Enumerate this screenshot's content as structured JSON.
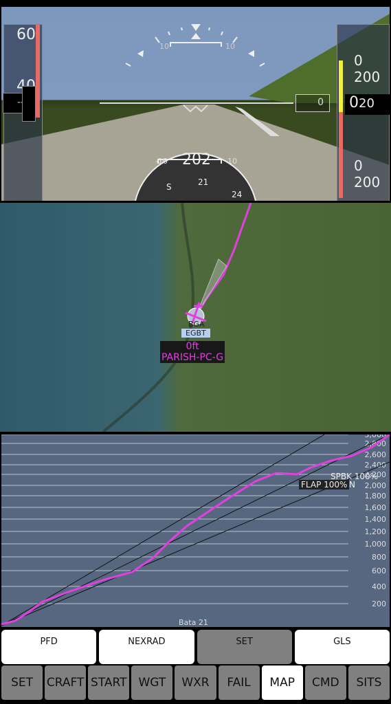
{
  "pfd": {
    "airspeed_ticks": [
      "60",
      "40"
    ],
    "airspeed_readout": "--",
    "pitch_labels": [
      "10",
      "10"
    ],
    "heading_readout": "202",
    "heading_side_labels": [
      "-10",
      "-10"
    ],
    "compass_labels": [
      "S",
      "21",
      "24"
    ],
    "altitude_labels": [
      "0 200",
      "0 200"
    ],
    "altitude_readout": "0",
    "altitude_drum": "20",
    "vsi_bug": "0"
  },
  "map": {
    "waypoint_labels": [
      "BGA",
      "EGBT",
      "BA"
    ],
    "aircraft_altitude": "0ft",
    "aircraft_name": "PARISH-PC-G"
  },
  "profile": {
    "y_labels": [
      "200",
      "400",
      "600",
      "800",
      "1,000",
      "1,200",
      "1,400",
      "1,600",
      "1,800",
      "2,000",
      "2,200",
      "2,400",
      "2,600",
      "2,800",
      "3,000"
    ],
    "markers": [
      "FLAP 100%",
      "SPBK 100%",
      "N"
    ],
    "runway_label": "Bata  21",
    "colors": {
      "path": "#e040e0",
      "background": "#56677f"
    }
  },
  "tabs": [
    {
      "label": "PFD"
    },
    {
      "label": "NEXRAD"
    },
    {
      "label": "SET",
      "selected": true
    },
    {
      "label": "GLS"
    }
  ],
  "buttons": [
    {
      "label": "SET"
    },
    {
      "label": "CRAFT"
    },
    {
      "label": "START"
    },
    {
      "label": "WGT"
    },
    {
      "label": "WXR"
    },
    {
      "label": "FAIL"
    },
    {
      "label": "MAP",
      "selected": true
    },
    {
      "label": "CMD"
    },
    {
      "label": "SITS"
    }
  ]
}
